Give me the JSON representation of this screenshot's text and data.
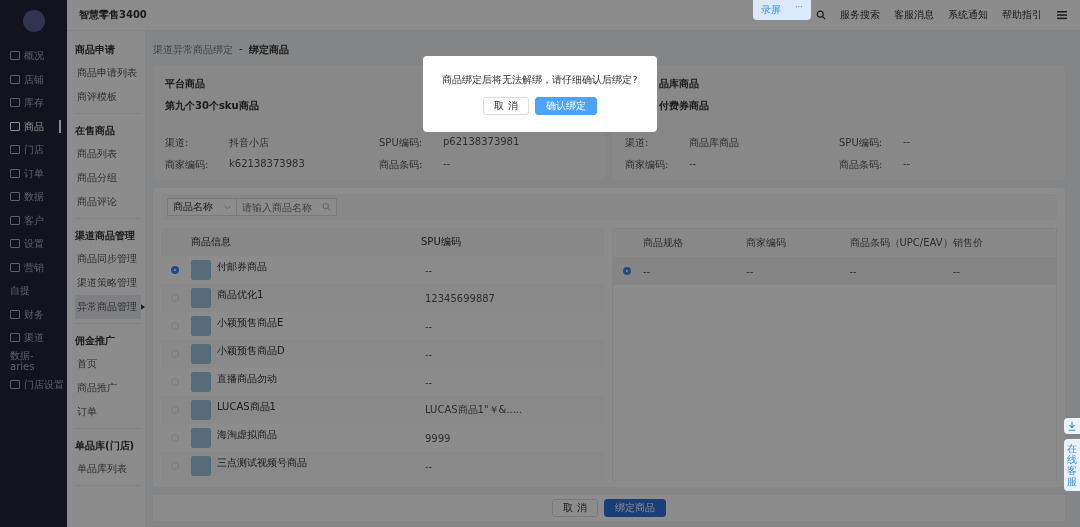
{
  "sidebar": {
    "items": [
      {
        "label": "概况",
        "selected": false,
        "icon": true
      },
      {
        "label": "店铺",
        "selected": false,
        "icon": true
      },
      {
        "label": "库存",
        "selected": false,
        "icon": true
      },
      {
        "label": "商品",
        "selected": true,
        "icon": true
      },
      {
        "label": "门店",
        "selected": false,
        "icon": true
      },
      {
        "label": "订单",
        "selected": false,
        "icon": true
      },
      {
        "label": "数据",
        "selected": false,
        "icon": true
      },
      {
        "label": "客户",
        "selected": false,
        "icon": true
      },
      {
        "label": "设置",
        "selected": false,
        "icon": true
      },
      {
        "label": "营销",
        "selected": false,
        "icon": true
      },
      {
        "label": "自提",
        "selected": false,
        "icon": false
      },
      {
        "label": "财务",
        "selected": false,
        "icon": true
      },
      {
        "label": "渠道",
        "selected": false,
        "icon": true
      },
      {
        "label": "数据-aries",
        "selected": false,
        "icon": false
      },
      {
        "label": "门店设置",
        "selected": false,
        "icon": true
      }
    ]
  },
  "app_title": "智慧零售3400",
  "submenu": [
    {
      "title": "商品申请",
      "items": [
        {
          "label": "商品申请列表",
          "selected": false
        },
        {
          "label": "商评模板",
          "selected": false
        }
      ]
    },
    {
      "title": "在售商品",
      "items": [
        {
          "label": "商品列表",
          "selected": false
        },
        {
          "label": "商品分组",
          "selected": false
        },
        {
          "label": "商品评论",
          "selected": false
        }
      ]
    },
    {
      "title": "渠道商品管理",
      "items": [
        {
          "label": "商品同步管理",
          "selected": false
        },
        {
          "label": "渠道策略管理",
          "selected": false
        },
        {
          "label": "异常商品管理",
          "selected": true
        }
      ]
    },
    {
      "title": "佣金推广",
      "items": [
        {
          "label": "首页",
          "selected": false
        },
        {
          "label": "商品推广",
          "selected": false
        },
        {
          "label": "订单",
          "selected": false
        }
      ]
    },
    {
      "title": "单品库(门店)",
      "items": [
        {
          "label": "单品库列表",
          "selected": false
        }
      ]
    }
  ],
  "recorder": {
    "label": "录屏",
    "more": "···"
  },
  "header_links": [
    "服务搜索",
    "客服消息",
    "系统通知",
    "帮助指引"
  ],
  "breadcrumb": {
    "parent": "渠道异常商品绑定",
    "separator": "-",
    "current": "绑定商品"
  },
  "platform_card": {
    "title": "平台商品",
    "name": "第九个30个sku商品",
    "fields": [
      {
        "label": "渠道:",
        "value": "抖音小店"
      },
      {
        "label": "SPU编码:",
        "value": "p62138373981"
      },
      {
        "label": "商家编码:",
        "value": "k62138373983"
      },
      {
        "label": "商品条码:",
        "value": "--"
      }
    ]
  },
  "library_card": {
    "title": "品库商品",
    "name": "付费券商品",
    "fields": [
      {
        "label": "渠道:",
        "value": "商品库商品"
      },
      {
        "label": "SPU编码:",
        "value": "--"
      },
      {
        "label": "商家编码:",
        "value": "--"
      },
      {
        "label": "商品条码:",
        "value": "--"
      }
    ]
  },
  "filter": {
    "select": "商品名称",
    "placeholder": "请输入商品名称"
  },
  "products_table": {
    "columns": [
      "商品信息",
      "SPU编码"
    ],
    "rows": [
      {
        "selected": true,
        "name": "付邮券商品",
        "spu": "--"
      },
      {
        "selected": false,
        "name": "商品优化1",
        "spu": "12345699887"
      },
      {
        "selected": false,
        "name": "小颖预售商品E",
        "spu": "--"
      },
      {
        "selected": false,
        "name": "小颖预售商品D",
        "spu": "--"
      },
      {
        "selected": false,
        "name": "直播商品勿动",
        "spu": "--"
      },
      {
        "selected": false,
        "name": "LUCAS商品1",
        "spu": "LUCAS商品1\"￥&....."
      },
      {
        "selected": false,
        "name": "海淘虚拟商品",
        "spu": "9999"
      },
      {
        "selected": false,
        "name": "三点测试视频号商品",
        "spu": "--"
      }
    ]
  },
  "sku_table": {
    "columns": [
      "商品规格",
      "商家编码",
      "商品条码（UPC/EAV）",
      "销售价"
    ],
    "rows": [
      {
        "selected": true,
        "cells": [
          "--",
          "--",
          "--",
          "--"
        ]
      }
    ]
  },
  "footer_buttons": {
    "cancel": "取 消",
    "confirm": "绑定商品"
  },
  "side_float": {
    "service": "在线客服"
  },
  "dialog": {
    "message": "商品绑定后将无法解绑，请仔细确认后绑定?",
    "cancel": "取 消",
    "confirm": "确认绑定"
  }
}
